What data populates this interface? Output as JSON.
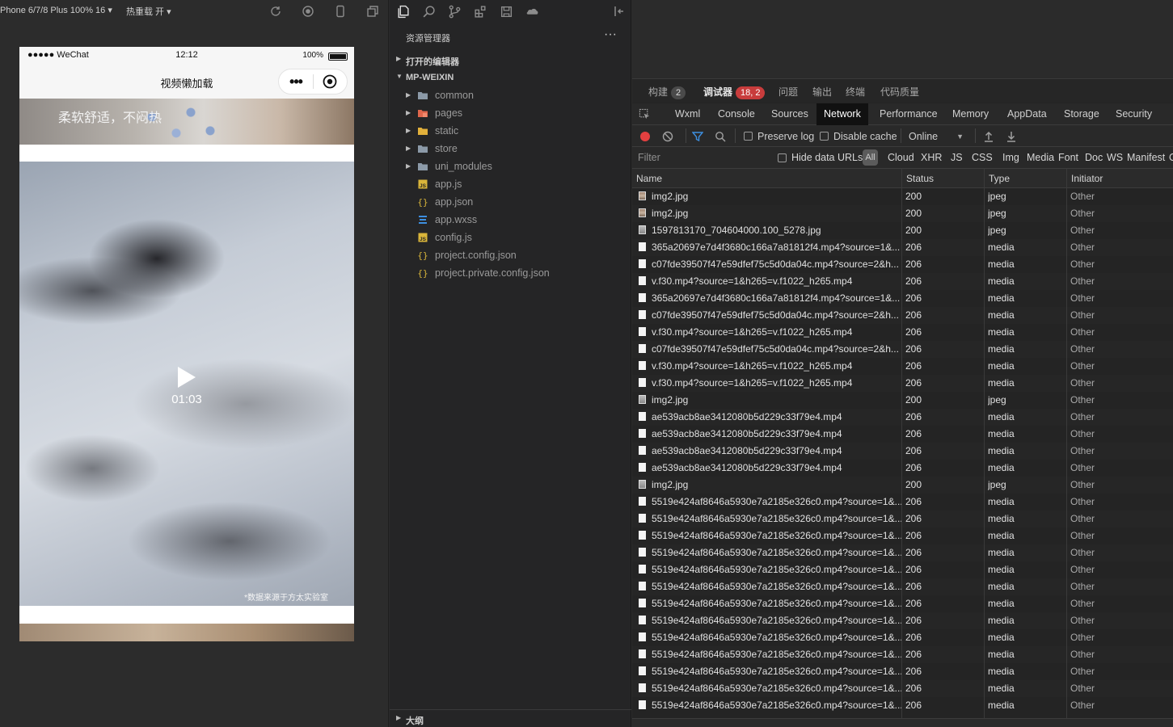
{
  "simulator": {
    "device": "Phone 6/7/8 Plus 100% 16 ▾",
    "hot_reload": "热重载 开 ▾"
  },
  "phone": {
    "carrier": "●●●●● WeChat",
    "time": "12:12",
    "battery": "100%",
    "nav_title": "视频懒加载",
    "capsule_menu": "•••",
    "banner_text": "柔软舒适，不闷热",
    "video_duration": "01:03",
    "source_note": "*数据来源于方太实验室"
  },
  "explorer": {
    "title": "资源管理器",
    "more": "···",
    "open_editors": "打开的编辑器",
    "project": "MP-WEIXIN",
    "outline": "大纲",
    "items": [
      {
        "name": "common",
        "icon": "folder-icon",
        "folder": true
      },
      {
        "name": "pages",
        "icon": "pages-folder-icon",
        "folder": true
      },
      {
        "name": "static",
        "icon": "static-folder-icon",
        "folder": true
      },
      {
        "name": "store",
        "icon": "folder-icon",
        "folder": true
      },
      {
        "name": "uni_modules",
        "icon": "folder-icon",
        "folder": true
      },
      {
        "name": "app.js",
        "icon": "js-file-icon",
        "folder": false
      },
      {
        "name": "app.json",
        "icon": "json-file-icon",
        "folder": false
      },
      {
        "name": "app.wxss",
        "icon": "css-file-icon",
        "folder": false
      },
      {
        "name": "config.js",
        "icon": "js-file-icon",
        "folder": false
      },
      {
        "name": "project.config.json",
        "icon": "json-file-icon",
        "folder": false
      },
      {
        "name": "project.private.config.json",
        "icon": "json-file-icon",
        "folder": false
      }
    ]
  },
  "devtools": {
    "panel_tabs": {
      "build": "构建",
      "build_badge": "2",
      "debugger": "调试器",
      "debugger_badge": "18, 2",
      "issues": "问题",
      "output": "输出",
      "terminal": "终端",
      "code_quality": "代码质量"
    },
    "tool_tabs": {
      "wxml": "Wxml",
      "console": "Console",
      "sources": "Sources",
      "network": "Network",
      "performance": "Performance",
      "memory": "Memory",
      "appdata": "AppData",
      "storage": "Storage",
      "security": "Security"
    },
    "toolbar": {
      "preserve_log": "Preserve log",
      "disable_cache": "Disable cache",
      "throttling": "Online"
    },
    "filter": {
      "placeholder": "Filter",
      "hide_data_urls": "Hide data URLs",
      "all": "All",
      "types": [
        "Cloud",
        "XHR",
        "JS",
        "CSS",
        "Img",
        "Media",
        "Font",
        "Doc",
        "WS",
        "Manifest",
        "O"
      ]
    },
    "columns": {
      "name": "Name",
      "status": "Status",
      "type": "Type",
      "initiator": "Initiator"
    },
    "requests": [
      {
        "name": "img2.jpg",
        "status": "200",
        "type": "jpeg",
        "initiator": "Other",
        "icon": "img"
      },
      {
        "name": "img2.jpg",
        "status": "200",
        "type": "jpeg",
        "initiator": "Other",
        "icon": "img"
      },
      {
        "name": "1597813170_704604000.100_5278.jpg",
        "status": "200",
        "type": "jpeg",
        "initiator": "Other",
        "icon": "imggray"
      },
      {
        "name": "365a20697e7d4f3680c166a7a81812f4.mp4?source=1&...",
        "status": "206",
        "type": "media",
        "initiator": "Other",
        "icon": "doc"
      },
      {
        "name": "c07fde39507f47e59dfef75c5d0da04c.mp4?source=2&h...",
        "status": "206",
        "type": "media",
        "initiator": "Other",
        "icon": "doc"
      },
      {
        "name": "v.f30.mp4?source=1&h265=v.f1022_h265.mp4",
        "status": "206",
        "type": "media",
        "initiator": "Other",
        "icon": "doc"
      },
      {
        "name": "365a20697e7d4f3680c166a7a81812f4.mp4?source=1&...",
        "status": "206",
        "type": "media",
        "initiator": "Other",
        "icon": "doc"
      },
      {
        "name": "c07fde39507f47e59dfef75c5d0da04c.mp4?source=2&h...",
        "status": "206",
        "type": "media",
        "initiator": "Other",
        "icon": "doc"
      },
      {
        "name": "v.f30.mp4?source=1&h265=v.f1022_h265.mp4",
        "status": "206",
        "type": "media",
        "initiator": "Other",
        "icon": "doc"
      },
      {
        "name": "c07fde39507f47e59dfef75c5d0da04c.mp4?source=2&h...",
        "status": "206",
        "type": "media",
        "initiator": "Other",
        "icon": "doc"
      },
      {
        "name": "v.f30.mp4?source=1&h265=v.f1022_h265.mp4",
        "status": "206",
        "type": "media",
        "initiator": "Other",
        "icon": "doc"
      },
      {
        "name": "v.f30.mp4?source=1&h265=v.f1022_h265.mp4",
        "status": "206",
        "type": "media",
        "initiator": "Other",
        "icon": "doc"
      },
      {
        "name": "img2.jpg",
        "status": "200",
        "type": "jpeg",
        "initiator": "Other",
        "icon": "imggray"
      },
      {
        "name": "ae539acb8ae3412080b5d229c33f79e4.mp4",
        "status": "206",
        "type": "media",
        "initiator": "Other",
        "icon": "doc"
      },
      {
        "name": "ae539acb8ae3412080b5d229c33f79e4.mp4",
        "status": "206",
        "type": "media",
        "initiator": "Other",
        "icon": "doc"
      },
      {
        "name": "ae539acb8ae3412080b5d229c33f79e4.mp4",
        "status": "206",
        "type": "media",
        "initiator": "Other",
        "icon": "doc"
      },
      {
        "name": "ae539acb8ae3412080b5d229c33f79e4.mp4",
        "status": "206",
        "type": "media",
        "initiator": "Other",
        "icon": "doc"
      },
      {
        "name": "img2.jpg",
        "status": "200",
        "type": "jpeg",
        "initiator": "Other",
        "icon": "imggray"
      },
      {
        "name": "5519e424af8646a5930e7a2185e326c0.mp4?source=1&...",
        "status": "206",
        "type": "media",
        "initiator": "Other",
        "icon": "doc"
      },
      {
        "name": "5519e424af8646a5930e7a2185e326c0.mp4?source=1&...",
        "status": "206",
        "type": "media",
        "initiator": "Other",
        "icon": "doc"
      },
      {
        "name": "5519e424af8646a5930e7a2185e326c0.mp4?source=1&...",
        "status": "206",
        "type": "media",
        "initiator": "Other",
        "icon": "doc"
      },
      {
        "name": "5519e424af8646a5930e7a2185e326c0.mp4?source=1&...",
        "status": "206",
        "type": "media",
        "initiator": "Other",
        "icon": "doc"
      },
      {
        "name": "5519e424af8646a5930e7a2185e326c0.mp4?source=1&...",
        "status": "206",
        "type": "media",
        "initiator": "Other",
        "icon": "doc"
      },
      {
        "name": "5519e424af8646a5930e7a2185e326c0.mp4?source=1&...",
        "status": "206",
        "type": "media",
        "initiator": "Other",
        "icon": "doc"
      },
      {
        "name": "5519e424af8646a5930e7a2185e326c0.mp4?source=1&...",
        "status": "206",
        "type": "media",
        "initiator": "Other",
        "icon": "doc"
      },
      {
        "name": "5519e424af8646a5930e7a2185e326c0.mp4?source=1&...",
        "status": "206",
        "type": "media",
        "initiator": "Other",
        "icon": "doc"
      },
      {
        "name": "5519e424af8646a5930e7a2185e326c0.mp4?source=1&...",
        "status": "206",
        "type": "media",
        "initiator": "Other",
        "icon": "doc"
      },
      {
        "name": "5519e424af8646a5930e7a2185e326c0.mp4?source=1&...",
        "status": "206",
        "type": "media",
        "initiator": "Other",
        "icon": "doc"
      },
      {
        "name": "5519e424af8646a5930e7a2185e326c0.mp4?source=1&...",
        "status": "206",
        "type": "media",
        "initiator": "Other",
        "icon": "doc"
      },
      {
        "name": "5519e424af8646a5930e7a2185e326c0.mp4?source=1&...",
        "status": "206",
        "type": "media",
        "initiator": "Other",
        "icon": "doc"
      },
      {
        "name": "5519e424af8646a5930e7a2185e326c0.mp4?source=1&...",
        "status": "206",
        "type": "media",
        "initiator": "Other",
        "icon": "doc"
      }
    ]
  },
  "colors": {
    "accent_red": "#c83c3c",
    "record_red": "#e34040",
    "filter_blue": "#3d8fe0"
  }
}
